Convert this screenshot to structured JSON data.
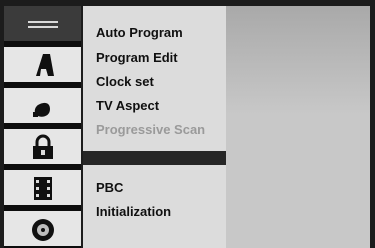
{
  "menu": {
    "items": [
      {
        "label": "Auto Program",
        "enabled": true
      },
      {
        "label": "Program Edit",
        "enabled": true
      },
      {
        "label": "Clock set",
        "enabled": true
      },
      {
        "label": "TV Aspect",
        "enabled": true
      },
      {
        "label": "Progressive Scan",
        "enabled": false
      }
    ],
    "items2": [
      {
        "label": "PBC",
        "enabled": true
      },
      {
        "label": "Initialization",
        "enabled": true
      }
    ]
  },
  "sidebar": {
    "tabs": [
      {
        "icon": "setup-lines-icon",
        "selected": true
      },
      {
        "icon": "language-a-icon",
        "selected": false
      },
      {
        "icon": "audio-icon",
        "selected": false
      },
      {
        "icon": "lock-icon",
        "selected": false
      },
      {
        "icon": "film-icon",
        "selected": false
      },
      {
        "icon": "disc-icon",
        "selected": false
      }
    ]
  }
}
